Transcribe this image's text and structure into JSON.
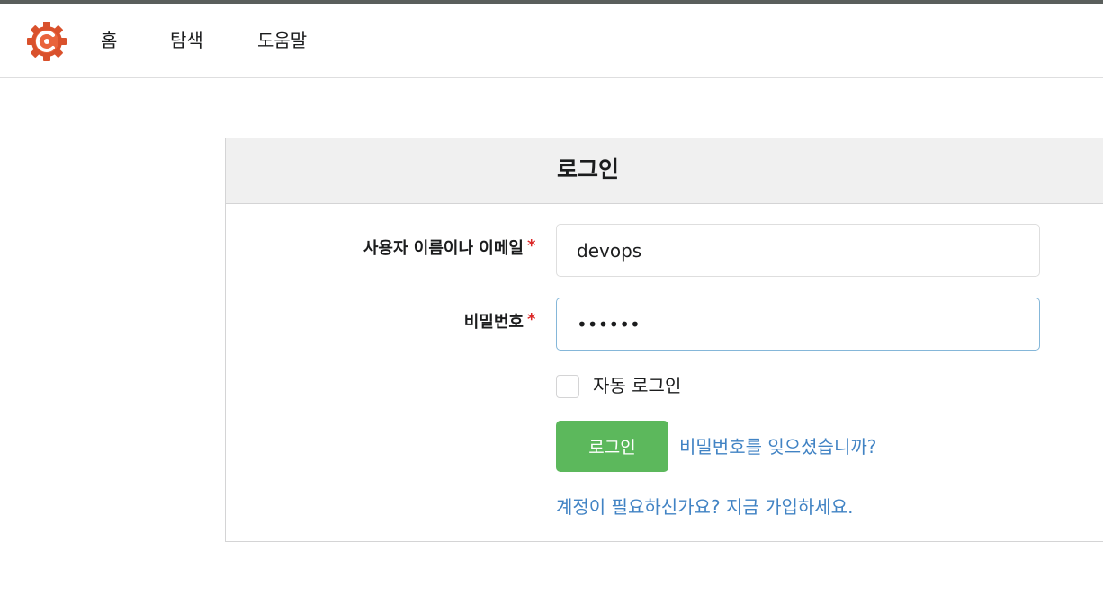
{
  "nav": {
    "logo_icon": "gitea-logo-icon",
    "items": [
      {
        "label": "홈"
      },
      {
        "label": "탐색"
      },
      {
        "label": "도움말"
      }
    ]
  },
  "login_form": {
    "title": "로그인",
    "username": {
      "label": "사용자 이름이나 이메일",
      "required_mark": "*",
      "value": "devops"
    },
    "password": {
      "label": "비밀번호",
      "required_mark": "*",
      "value": "••••••"
    },
    "remember": {
      "label": "자동 로그인",
      "checked": false
    },
    "submit_label": "로그인",
    "forgot_password_link": "비밀번호를 잊으셨습니까?",
    "signup_link": "계정이 필요하신가요? 지금 가입하세요."
  },
  "colors": {
    "primary_button": "#5cb85c",
    "link": "#4183c4",
    "required": "#db2828",
    "header_bg": "#f0f0f0",
    "logo": "#d9512c"
  }
}
